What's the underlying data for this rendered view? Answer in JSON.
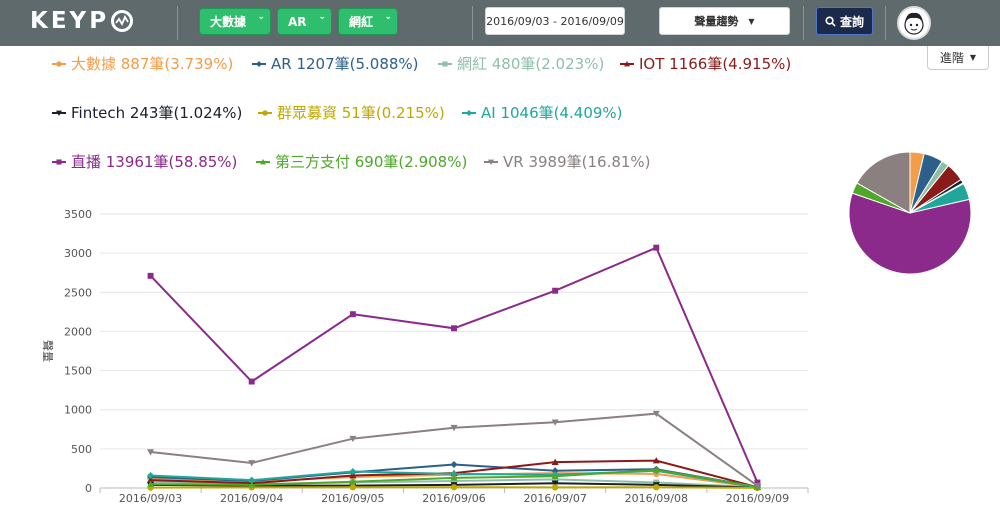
{
  "header": {
    "logo": "KEYP",
    "filters": [
      "大數據",
      "AR",
      "網紅"
    ],
    "date_range": "2016/09/03 - 2016/09/09",
    "trend_select": "聲量趨勢",
    "query_label": "查詢",
    "advanced_label": "進階"
  },
  "legend": [
    {
      "text": "大數據 887筆(3.739%)",
      "color": "#f39c4a",
      "marker": "circle"
    },
    {
      "text": "AR 1207筆(5.088%)",
      "color": "#2c5f8a",
      "marker": "diamond"
    },
    {
      "text": "網紅 480筆(2.023%)",
      "color": "#8fbfa8",
      "marker": "square"
    },
    {
      "text": "IOT 1166筆(4.915%)",
      "color": "#8b1a1a",
      "marker": "triangle"
    },
    {
      "text": "Fintech 243筆(1.024%)",
      "color": "#1a2030",
      "marker": "triangle-down"
    },
    {
      "text": "群眾募資 51筆(0.215%)",
      "color": "#c0a800",
      "marker": "circle"
    },
    {
      "text": "AI 1046筆(4.409%)",
      "color": "#1fa89a",
      "marker": "diamond"
    },
    {
      "text": "直播 13961筆(58.85%)",
      "color": "#8b2a8a",
      "marker": "square"
    },
    {
      "text": "第三方支付 690筆(2.908%)",
      "color": "#4fa82a",
      "marker": "triangle"
    },
    {
      "text": "VR 3989筆(16.81%)",
      "color": "#8a8080",
      "marker": "triangle-down"
    }
  ],
  "chart_data": [
    {
      "type": "line",
      "ylabel": "聲量",
      "xlabel": "",
      "ylim": [
        0,
        3500
      ],
      "yticks": [
        0,
        500,
        1000,
        1500,
        2000,
        2500,
        3000,
        3500
      ],
      "categories": [
        "2016/09/03",
        "2016/09/04",
        "2016/09/05",
        "2016/09/06",
        "2016/09/07",
        "2016/09/08",
        "2016/09/09"
      ],
      "grid": true,
      "series": [
        {
          "name": "大數據",
          "color": "#f39c4a",
          "marker": "circle",
          "values": [
            120,
            80,
            140,
            170,
            190,
            180,
            10
          ]
        },
        {
          "name": "AR",
          "color": "#2c5f8a",
          "marker": "diamond",
          "values": [
            140,
            90,
            200,
            300,
            220,
            240,
            15
          ]
        },
        {
          "name": "網紅",
          "color": "#8fbfa8",
          "marker": "square",
          "values": [
            80,
            50,
            70,
            90,
            110,
            70,
            10
          ]
        },
        {
          "name": "IOT",
          "color": "#8b1a1a",
          "marker": "triangle",
          "values": [
            100,
            60,
            160,
            190,
            330,
            350,
            10
          ]
        },
        {
          "name": "Fintech",
          "color": "#1a2030",
          "marker": "triangle-down",
          "values": [
            40,
            30,
            30,
            40,
            60,
            40,
            5
          ]
        },
        {
          "name": "群眾募資",
          "color": "#c0a800",
          "marker": "circle",
          "values": [
            5,
            8,
            10,
            10,
            8,
            10,
            2
          ]
        },
        {
          "name": "AI",
          "color": "#1fa89a",
          "marker": "diamond",
          "values": [
            160,
            100,
            210,
            180,
            170,
            220,
            10
          ]
        },
        {
          "name": "直播",
          "color": "#8b2a8a",
          "marker": "square",
          "values": [
            2710,
            1360,
            2220,
            2040,
            2520,
            3070,
            70
          ]
        },
        {
          "name": "第三方支付",
          "color": "#4fa82a",
          "marker": "triangle",
          "values": [
            50,
            40,
            80,
            130,
            150,
            230,
            15
          ]
        },
        {
          "name": "VR",
          "color": "#8a8080",
          "marker": "triangle-down",
          "values": [
            460,
            320,
            630,
            770,
            840,
            950,
            30
          ]
        }
      ]
    },
    {
      "type": "pie",
      "labels": [
        "大數據",
        "AR",
        "網紅",
        "IOT",
        "Fintech",
        "群眾募資",
        "AI",
        "直播",
        "第三方支付",
        "VR"
      ],
      "values": [
        3.739,
        5.088,
        2.023,
        4.915,
        1.024,
        0.215,
        4.409,
        58.85,
        2.908,
        16.81
      ],
      "colors": [
        "#f39c4a",
        "#2c5f8a",
        "#8fbfa8",
        "#8b1a1a",
        "#1a2030",
        "#c0a800",
        "#1fa89a",
        "#8b2a8a",
        "#4fa82a",
        "#8a8080"
      ]
    }
  ]
}
